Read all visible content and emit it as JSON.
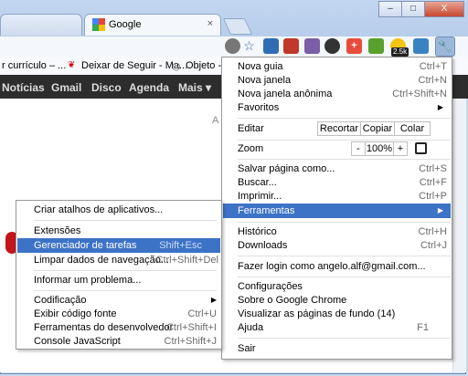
{
  "tabs": [
    {
      "title": "",
      "active": false
    },
    {
      "title": "Google",
      "active": true,
      "close": "×"
    }
  ],
  "window_controls": {
    "minimize": "–",
    "maximize": "□",
    "close": "X"
  },
  "toolbar": {
    "badge": "2.5k"
  },
  "bookmarks": [
    {
      "label": "r currículo – ..."
    },
    {
      "label": "Deixar de Seguir - Ma..."
    },
    {
      "label": "Objeto - A"
    }
  ],
  "google_bar": {
    "items": [
      "Notícias",
      "Gmail",
      "Disco",
      "Agenda",
      "Mais ▾"
    ]
  },
  "page": {
    "partial_text": "A"
  },
  "main_menu": {
    "new_tab": {
      "label": "Nova guia",
      "shortcut": "Ctrl+T"
    },
    "new_window": {
      "label": "Nova janela",
      "shortcut": "Ctrl+N"
    },
    "incognito": {
      "label": "Nova janela anônima",
      "shortcut": "Ctrl+Shift+N"
    },
    "favorites": {
      "label": "Favoritos"
    },
    "edit": {
      "label": "Editar",
      "cut": "Recortar",
      "copy": "Copiar",
      "paste": "Colar"
    },
    "zoom": {
      "label": "Zoom",
      "minus": "-",
      "value": "100%",
      "plus": "+"
    },
    "save_page": {
      "label": "Salvar página como...",
      "shortcut": "Ctrl+S"
    },
    "find": {
      "label": "Buscar...",
      "shortcut": "Ctrl+F"
    },
    "print": {
      "label": "Imprimir...",
      "shortcut": "Ctrl+P"
    },
    "tools": {
      "label": "Ferramentas"
    },
    "history": {
      "label": "Histórico",
      "shortcut": "Ctrl+H"
    },
    "downloads": {
      "label": "Downloads",
      "shortcut": "Ctrl+J"
    },
    "login": {
      "label": "Fazer login como angelo.alf@gmail.com..."
    },
    "settings": {
      "label": "Configurações"
    },
    "about": {
      "label": "Sobre o Google Chrome"
    },
    "background_pages": {
      "label": "Visualizar as páginas de fundo (14)"
    },
    "help": {
      "label": "Ajuda",
      "shortcut": "F1"
    },
    "exit": {
      "label": "Sair"
    }
  },
  "tools_menu": {
    "create_shortcuts": {
      "label": "Criar atalhos de aplicativos..."
    },
    "extensions": {
      "label": "Extensões"
    },
    "task_manager": {
      "label": "Gerenciador de tarefas",
      "shortcut": "Shift+Esc"
    },
    "clear_data": {
      "label": "Limpar dados de navegação...",
      "shortcut": "Ctrl+Shift+Del"
    },
    "report_issue": {
      "label": "Informar um problema..."
    },
    "encoding": {
      "label": "Codificação"
    },
    "view_source": {
      "label": "Exibir código fonte",
      "shortcut": "Ctrl+U"
    },
    "dev_tools": {
      "label": "Ferramentas do desenvolvedor",
      "shortcut": "Ctrl+Shift+I"
    },
    "js_console": {
      "label": "Console JavaScript",
      "shortcut": "Ctrl+Shift+J"
    }
  },
  "colors": {
    "highlight": "#3c73c7",
    "gbar": "#2d2d2d",
    "google_red": "#c3161c"
  }
}
